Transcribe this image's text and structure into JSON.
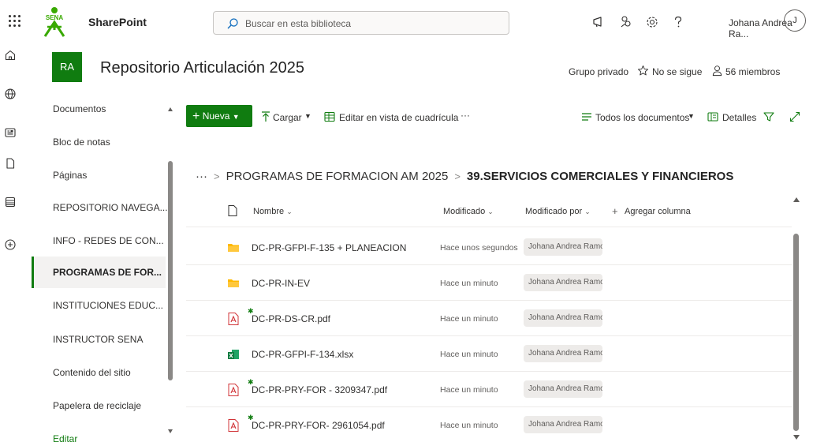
{
  "colors": {
    "accent": "#107c10",
    "folder": "#ffb900",
    "pdf": "#d13438",
    "excel": "#107c41"
  },
  "app": {
    "title": "SharePoint"
  },
  "search": {
    "placeholder": "Buscar en esta biblioteca"
  },
  "user": {
    "name": "Johana Andrea Ra...",
    "initials": "J"
  },
  "top_icons": [
    "megaphone-icon",
    "people-icon",
    "gear-icon",
    "help-icon"
  ],
  "rail": [
    "home-icon",
    "globe-icon",
    "news-icon",
    "file-icon",
    "list-icon",
    "add-icon"
  ],
  "site": {
    "logo": "RA",
    "title": "Repositorio Articulación 2025",
    "privacy": "Grupo privado",
    "follow": "No se sigue",
    "members": "56 miembros"
  },
  "nav": {
    "items": [
      {
        "label": "Documentos"
      },
      {
        "label": "Bloc de notas"
      },
      {
        "label": "Páginas"
      },
      {
        "label": "REPOSITORIO NAVEGA..."
      },
      {
        "label": "INFO - REDES DE CON..."
      },
      {
        "label": "PROGRAMAS DE FOR...",
        "selected": true
      },
      {
        "label": "INSTITUCIONES EDUC..."
      },
      {
        "label": "INSTRUCTOR SENA"
      },
      {
        "label": "Contenido del sitio"
      },
      {
        "label": "Papelera de reciclaje"
      },
      {
        "label": "Editar"
      }
    ]
  },
  "commands": {
    "new": "Nueva",
    "upload": "Cargar",
    "grid": "Editar en vista de cuadrícula",
    "more": "···",
    "view": "Todos los documentos",
    "details": "Detalles"
  },
  "breadcrumb": {
    "ellipsis": "···",
    "parent": "PROGRAMAS DE FORMACION AM 2025",
    "current": "39.SERVICIOS COMERCIALES Y FINANCIEROS"
  },
  "list": {
    "columns": {
      "name": "Nombre",
      "modified": "Modificado",
      "modified_by": "Modificado por",
      "add": "Agregar columna"
    },
    "rows": [
      {
        "type": "folder",
        "name": "DC-PR-GFPI-F-135 + PLANEACION",
        "modified": "Hace unos segundos",
        "by": "Johana Andrea Ramos"
      },
      {
        "type": "folder",
        "name": "DC-PR-IN-EV",
        "modified": "Hace un minuto",
        "by": "Johana Andrea Ramos"
      },
      {
        "type": "pdf",
        "name": "DC-PR-DS-CR.pdf",
        "modified": "Hace un minuto",
        "by": "Johana Andrea Ramos"
      },
      {
        "type": "excel",
        "name": "DC-PR-GFPI-F-134.xlsx",
        "modified": "Hace un minuto",
        "by": "Johana Andrea Ramos"
      },
      {
        "type": "pdf",
        "name": "DC-PR-PRY-FOR - 3209347.pdf",
        "modified": "Hace un minuto",
        "by": "Johana Andrea Ramos"
      },
      {
        "type": "pdf",
        "name": "DC-PR-PRY-FOR- 2961054.pdf",
        "modified": "Hace un minuto",
        "by": "Johana Andrea Ramos"
      }
    ]
  }
}
